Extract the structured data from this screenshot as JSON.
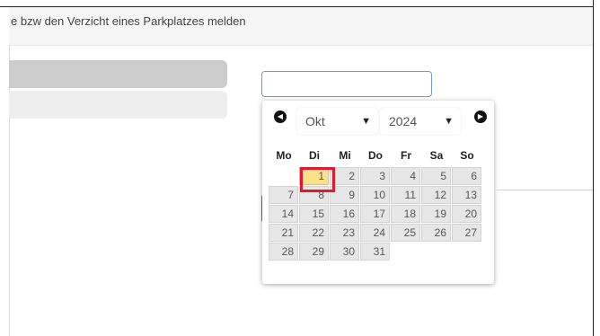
{
  "header": {
    "title": "e bzw den Verzicht eines Parkplatzes melden"
  },
  "form": {
    "date_value": ""
  },
  "datepicker": {
    "prev_symbol": "◀",
    "next_symbol": "▶",
    "month": "Okt",
    "year": "2024",
    "caret": "▼",
    "weekdays": [
      "Mo",
      "Di",
      "Mi",
      "Do",
      "Fr",
      "Sa",
      "So"
    ],
    "weeks": [
      [
        "",
        "1",
        "2",
        "3",
        "4",
        "5",
        "6"
      ],
      [
        "7",
        "8",
        "9",
        "10",
        "11",
        "12",
        "13"
      ],
      [
        "14",
        "15",
        "16",
        "17",
        "18",
        "19",
        "20"
      ],
      [
        "21",
        "22",
        "23",
        "24",
        "25",
        "26",
        "27"
      ],
      [
        "28",
        "29",
        "30",
        "31",
        "",
        "",
        ""
      ]
    ],
    "highlighted_day": "1"
  }
}
